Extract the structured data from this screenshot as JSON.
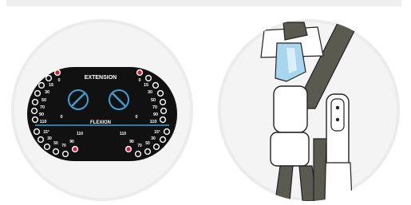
{
  "dial": {
    "extension_label": "EXTENSION",
    "flexion_label": "FLEXION",
    "left_ext_scale": [
      "0",
      "15",
      "30",
      "50",
      "70",
      "90",
      "110"
    ],
    "right_ext_scale": [
      "0",
      "15",
      "30",
      "50",
      "70",
      "90",
      "110"
    ],
    "mid_left_zero": "0",
    "mid_right_zero": "0",
    "left_flex_scale": [
      "15°",
      "30",
      "50",
      "70",
      "90",
      "110"
    ],
    "right_flex_scale": [
      "110",
      "90",
      "70",
      "50",
      "30",
      "15°"
    ],
    "colors": {
      "body": "#111111",
      "accent": "#d1202f",
      "lines": "#3aa0d8"
    }
  },
  "brace": {
    "colors": {
      "strap": "#5a5a50",
      "pad": "#a9d6ef",
      "frame": "#ffffff",
      "outline": "#222222"
    }
  }
}
